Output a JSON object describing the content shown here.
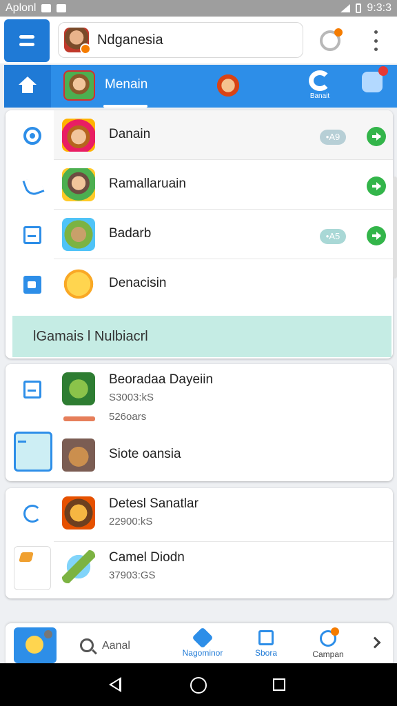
{
  "status_bar": {
    "carrier": "Aplonl",
    "time": "9:3:3"
  },
  "app_bar": {
    "search_value": "Ndganesia"
  },
  "tabs": {
    "active_label": "Menain",
    "extra_label": "Banait"
  },
  "list_primary": [
    {
      "title": "Danain",
      "badge": "•A9",
      "icon": "target-icon",
      "has_action": true
    },
    {
      "title": "Ramallaruain",
      "badge": "",
      "icon": "phone-icon",
      "has_action": true
    },
    {
      "title": "Badarb",
      "badge": "•A5",
      "icon": "document-icon",
      "has_action": true
    },
    {
      "title": "Denacisin",
      "badge": "",
      "icon": "chart-icon",
      "has_action": false
    }
  ],
  "banner": {
    "text": "lGamais l Nulbiacrl"
  },
  "list_secondary": [
    {
      "title": "Beoradaa Dayeiin",
      "sub": "S3003:kS",
      "sub2": "526oars",
      "progress": 1.0
    },
    {
      "title": "Siote oansia"
    }
  ],
  "list_tertiary": [
    {
      "title": "Detesl Sanatlar",
      "sub": "22900:kS"
    },
    {
      "title": "Camel Diodn",
      "sub": "37903:GS"
    }
  ],
  "bottom_bar": {
    "search_label": "Aanal",
    "items": [
      {
        "label": "Nagominor"
      },
      {
        "label": "Sbora"
      },
      {
        "label": "Campan"
      }
    ]
  },
  "colors": {
    "primary": "#2d8ee8",
    "primary_dark": "#1f7ad6",
    "action_green": "#33b54a",
    "banner": "#c5ece4"
  }
}
